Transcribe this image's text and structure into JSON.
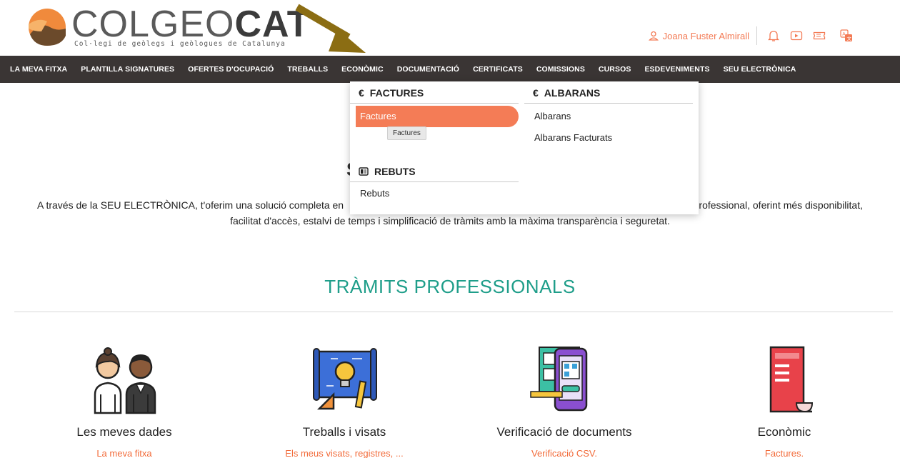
{
  "logo": {
    "name_light": "COLGEO",
    "name_bold": "CAT",
    "subtitle": "Col·legi de geòlegs i geòlogues de Catalunya"
  },
  "header": {
    "user_name": "Joana Fuster Almirall",
    "icons": [
      "user-icon",
      "bell-icon",
      "video-icon",
      "ticket-icon",
      "translate-icon"
    ]
  },
  "nav": {
    "items": [
      "LA MEVA FITXA",
      "PLANTILLA SIGNATURES",
      "OFERTES D'OCUPACIÓ",
      "TREBALLS",
      "ECONÒMIC",
      "DOCUMENTACIÓ",
      "CERTIFICATS",
      "COMISSIONS",
      "CURSOS",
      "ESDEVENIMENTS",
      "SEU ELECTRÒNICA"
    ]
  },
  "dropdown": {
    "factures": {
      "symbol": "€",
      "title": "FACTURES",
      "items": [
        "Factures"
      ]
    },
    "rebuts": {
      "title": "REBUTS",
      "items": [
        "Rebuts"
      ]
    },
    "albarans": {
      "symbol": "€",
      "title": "ALBARANS",
      "items": [
        "Albarans",
        "Albarans Facturats"
      ]
    },
    "tooltip": "Factures"
  },
  "main": {
    "heading_fragment": "S",
    "intro_line1": "A través de la SEU ELECTRÒNICA, t'oferim una solució completa en",
    "intro_line1_end": "Professional, oferint més disponibilitat,",
    "intro_line2": "facilitat d'accès, estalvi de temps i simplificació de tràmits amb la màxima transparència i seguretat.",
    "section_title": "TRÀMITS PROFESSIONALS"
  },
  "cards": [
    {
      "title": "Les meves dades",
      "link": "La meva fitxa",
      "icon": "people-icon"
    },
    {
      "title": "Treballs i visats",
      "link": "Els meus visats, registres, ...",
      "icon": "blueprint-icon"
    },
    {
      "title": "Verificació de documents",
      "link": "Verificació CSV.",
      "icon": "qr-phone-icon"
    },
    {
      "title": "Econòmic",
      "link": "Factures.",
      "icon": "invoice-icon"
    }
  ],
  "colors": {
    "accent": "#f47c56",
    "nav_bg": "#3a3534",
    "teal": "#1f9e8a",
    "arrow": "#8b6d13"
  }
}
